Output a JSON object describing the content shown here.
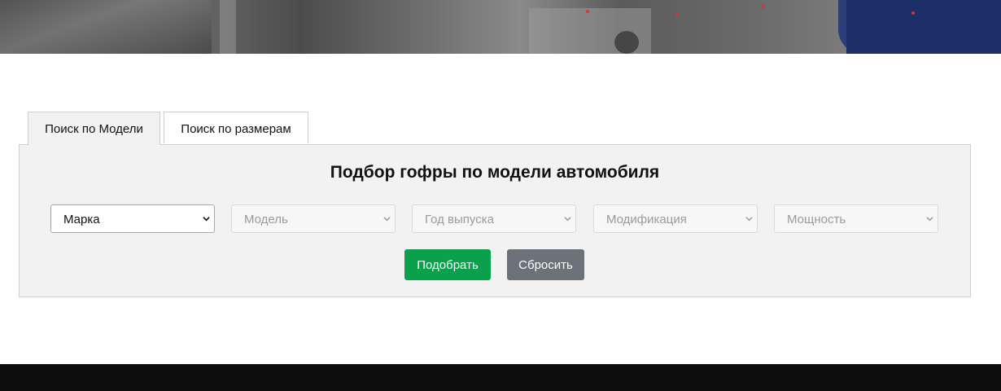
{
  "tabs": [
    {
      "label": "Поиск по Модели",
      "active": true
    },
    {
      "label": "Поиск по размерам",
      "active": false
    }
  ],
  "panel": {
    "title": "Подбор гофры по модели автомобиля"
  },
  "selects": [
    {
      "value": "Марка",
      "enabled": true
    },
    {
      "value": "Модель",
      "enabled": false
    },
    {
      "value": "Год выпуска",
      "enabled": false
    },
    {
      "value": "Модификация",
      "enabled": false
    },
    {
      "value": "Мощность",
      "enabled": false
    }
  ],
  "buttons": {
    "submit_label": "Подобрать",
    "reset_label": "Сбросить"
  },
  "colors": {
    "submit": "#0aa04c",
    "reset": "#6c7279",
    "footer": "#0c0c0c",
    "panel_bg": "#f2f2f2"
  },
  "icons": {
    "select_arrow": "chevron-down-icon"
  }
}
